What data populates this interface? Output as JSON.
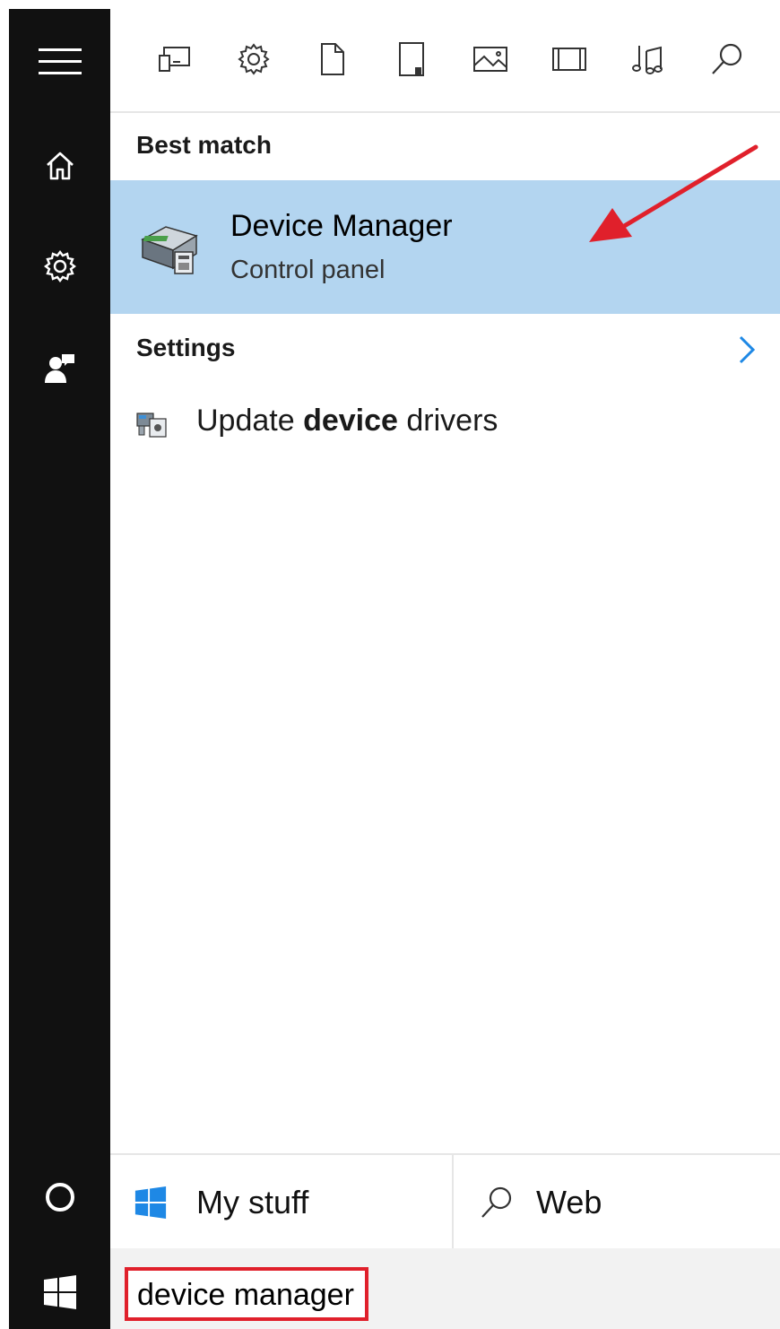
{
  "rail": {
    "items": [
      {
        "name": "hamburger-menu-icon"
      },
      {
        "name": "home-icon"
      },
      {
        "name": "settings-icon"
      },
      {
        "name": "feedback-icon"
      },
      {
        "name": "cortana-icon"
      },
      {
        "name": "start-windows-icon"
      }
    ]
  },
  "filters": [
    {
      "name": "filter-apps-icon"
    },
    {
      "name": "filter-settings-icon"
    },
    {
      "name": "filter-documents-icon"
    },
    {
      "name": "filter-folders-icon"
    },
    {
      "name": "filter-photos-icon"
    },
    {
      "name": "filter-videos-icon"
    },
    {
      "name": "filter-music-icon"
    },
    {
      "name": "filter-search-icon"
    }
  ],
  "best_match": {
    "header": "Best match",
    "title": "Device Manager",
    "subtitle": "Control panel"
  },
  "settings": {
    "header": "Settings",
    "item_prefix": "Update ",
    "item_bold": "device",
    "item_suffix": " drivers"
  },
  "tabs": {
    "my_stuff": "My stuff",
    "web": "Web"
  },
  "search": {
    "value": "device manager"
  },
  "colors": {
    "rail_bg": "#111111",
    "highlight_bg": "#b3d5f0",
    "accent_blue": "#1e88e5",
    "annotation_red": "#e0202b"
  }
}
